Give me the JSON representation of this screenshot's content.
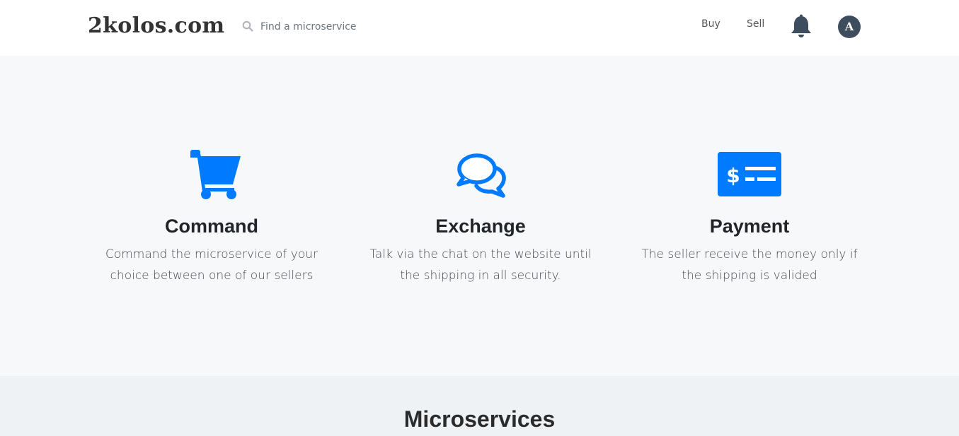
{
  "navbar": {
    "brand": "2kolos.com",
    "search": {
      "placeholder": "Find a microservice",
      "value": "",
      "icon": "search-icon"
    },
    "links": {
      "buy": "Buy",
      "sell": "Sell"
    },
    "notifications_icon": "bell-icon",
    "avatar_initial": "A"
  },
  "features": [
    {
      "icon": "shopping-cart-icon",
      "title": "Command",
      "line1": "Command the microservice of your",
      "line2": "choice between one of our sellers"
    },
    {
      "icon": "chat-bubbles-icon",
      "title": "Exchange",
      "line1": "Talk via the chat on the website until",
      "line2": "the shipping in all security."
    },
    {
      "icon": "money-check-icon",
      "title": "Payment",
      "line1": "The seller receive the money only if",
      "line2": "the shipping is valided"
    }
  ],
  "microservices": {
    "title": "Microservices"
  },
  "colors": {
    "accent": "#007bff",
    "features_bg": "#f7f8fa",
    "micro_bg": "#eef2f5",
    "avatar_bg": "#3d4d5e",
    "bell": "#3d4d5e"
  }
}
